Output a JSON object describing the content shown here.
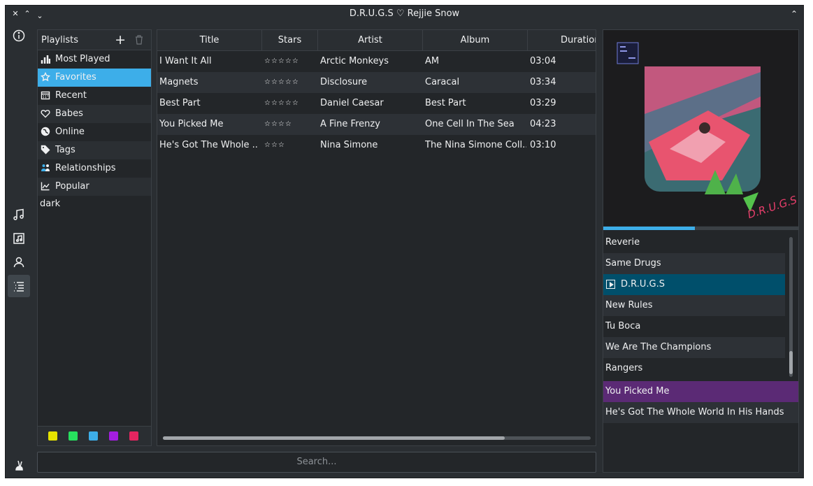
{
  "window": {
    "title": "D.R.U.G.S ♡ Rejjie Snow",
    "controls": [
      "close",
      "minimize",
      "maximize",
      "keep-above"
    ]
  },
  "sidebar_nav": [
    {
      "icon": "info-icon"
    },
    {
      "icon": "music-note-icon"
    },
    {
      "icon": "album-icon"
    },
    {
      "icon": "artist-icon"
    },
    {
      "icon": "playlist-icon",
      "active": true
    },
    {
      "icon": "rabbit-icon"
    }
  ],
  "playlists": {
    "header": "Playlists",
    "add_label": "+",
    "items": [
      {
        "label": "Most Played",
        "icon": "bar-chart-icon"
      },
      {
        "label": "Favorites",
        "icon": "star-icon",
        "selected": true
      },
      {
        "label": "Recent",
        "icon": "calendar-icon"
      },
      {
        "label": "Babes",
        "icon": "heart-icon"
      },
      {
        "label": "Online",
        "icon": "globe-icon"
      },
      {
        "label": "Tags",
        "icon": "tag-icon"
      },
      {
        "label": "Relationships",
        "icon": "people-icon"
      },
      {
        "label": "Popular",
        "icon": "trend-icon"
      }
    ],
    "extra": "dark",
    "color_tags": [
      "#e5e300",
      "#27e05e",
      "#3daee9",
      "#a31ee0",
      "#e52560"
    ]
  },
  "tracks": {
    "columns": [
      "Title",
      "Stars",
      "Artist",
      "Album",
      "Duration"
    ],
    "rows": [
      {
        "title": "I Want It All",
        "stars": "☆☆☆☆☆",
        "artist": "Arctic Monkeys",
        "album": "AM",
        "duration": "03:04"
      },
      {
        "title": "Magnets",
        "stars": "☆☆☆☆☆",
        "artist": "Disclosure",
        "album": "Caracal",
        "duration": "03:34"
      },
      {
        "title": "Best Part",
        "stars": "☆☆☆☆☆",
        "artist": "Daniel Caesar",
        "album": "Best Part",
        "duration": "03:29"
      },
      {
        "title": "You Picked Me",
        "stars": "☆☆☆☆",
        "artist": "A Fine Frenzy",
        "album": "One Cell In The Sea",
        "duration": "04:23"
      },
      {
        "title": "He's Got The Whole ...",
        "stars": "☆☆☆",
        "artist": "Nina Simone",
        "album": "The Nina Simone Coll...",
        "duration": "03:10"
      }
    ]
  },
  "search": {
    "placeholder": "Search..."
  },
  "now_playing": {
    "progress": 0.47,
    "queue": [
      "Reverie",
      "Same Drugs",
      "D.R.U.G.S",
      "New Rules",
      "Tu Boca",
      "We Are The Champions",
      "Rangers"
    ],
    "current_index": 2,
    "up_next": [
      "You Picked Me",
      "He's Got The Whole World In His Hands"
    ]
  },
  "colors": {
    "accent": "#3daee9",
    "current_track": "#004f6b",
    "highlight_purple": "#5b2a75"
  }
}
